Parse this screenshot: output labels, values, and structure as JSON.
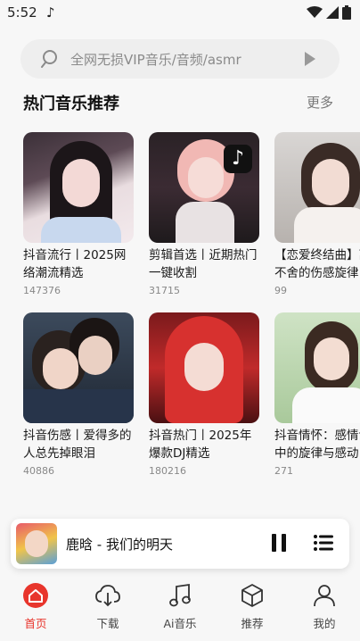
{
  "status_bar": {
    "time": "5:52"
  },
  "search": {
    "placeholder": "全网无损VIP音乐/音频/asmr"
  },
  "section": {
    "title": "热门音乐推荐",
    "more_label": "更多"
  },
  "cards": [
    {
      "title": "抖音流行丨2025网络潮流精选",
      "count": "147376"
    },
    {
      "title": "剪辑首选丨近期热门一键收割",
      "count": "31715"
    },
    {
      "title": "【恋爱终结曲】离别不舍的伤感旋律",
      "count": "99"
    },
    {
      "title": "抖音伤感丨爱得多的人总先掉眼泪",
      "count": "40886"
    },
    {
      "title": "抖音热门丨2025年爆款DJ精选",
      "count": "180216"
    },
    {
      "title": "抖音情怀：感情记忆中的旋律与感动",
      "count": "271"
    }
  ],
  "player": {
    "song": "鹿晗 - 我们的明天"
  },
  "nav": [
    {
      "label": "首页",
      "icon": "home-icon"
    },
    {
      "label": "下载",
      "icon": "cloud-download-icon"
    },
    {
      "label": "Ai音乐",
      "icon": "music-note-icon"
    },
    {
      "label": "推荐",
      "icon": "cube-icon"
    },
    {
      "label": "我的",
      "icon": "user-icon"
    }
  ],
  "colors": {
    "accent": "#e8352c",
    "background": "#f7f7f7"
  }
}
